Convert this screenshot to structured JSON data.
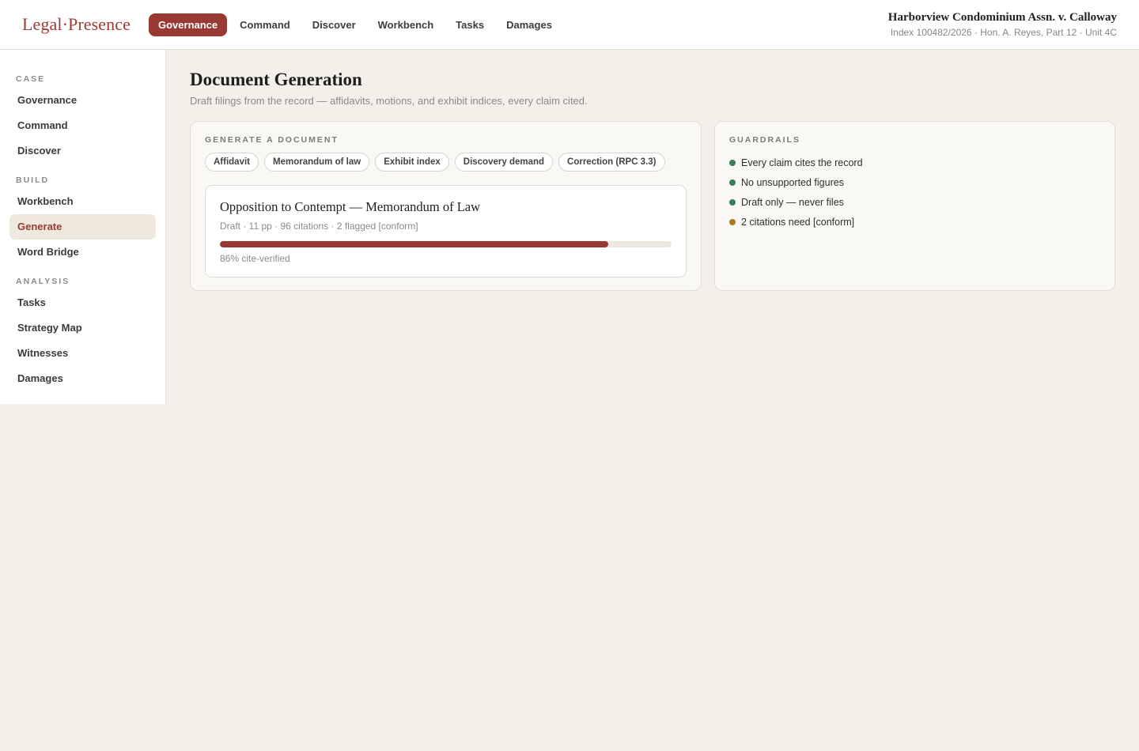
{
  "brand": {
    "logo": "Legal·Presence"
  },
  "topnav": {
    "items": [
      {
        "label": "Governance",
        "active": true
      },
      {
        "label": "Command",
        "active": false
      },
      {
        "label": "Discover",
        "active": false
      },
      {
        "label": "Workbench",
        "active": false
      },
      {
        "label": "Tasks",
        "active": false
      },
      {
        "label": "Damages",
        "active": false
      }
    ]
  },
  "case": {
    "title": "Harborview Condominium Assn. v. Calloway",
    "subtitle": "Index 100482/2026 · Hon. A. Reyes, Part 12 · Unit 4C"
  },
  "sidebar": {
    "sections": [
      {
        "label": "CASE",
        "items": [
          "Governance",
          "Command",
          "Discover"
        ]
      },
      {
        "label": "BUILD",
        "items": [
          "Workbench",
          "Generate",
          "Word Bridge"
        ]
      },
      {
        "label": "ANALYSIS",
        "items": [
          "Tasks",
          "Strategy Map",
          "Witnesses",
          "Damages"
        ]
      }
    ],
    "active_item": "Generate"
  },
  "page": {
    "title": "Document Generation",
    "subtitle": "Draft filings from the record — affidavits, motions, and exhibit indices, every claim cited."
  },
  "generate": {
    "label": "GENERATE A DOCUMENT",
    "doc_types": [
      "Affidavit",
      "Memorandum of law",
      "Exhibit index",
      "Discovery demand",
      "Correction (RPC 3.3)"
    ],
    "document": {
      "title": "Opposition to Contempt — Memorandum of Law",
      "meta": "Draft · 11 pp · 96 citations · 2 flagged [conform]",
      "progress_percent": 86,
      "progress_label": "86% cite-verified"
    }
  },
  "guardrails": {
    "label": "GUARDRAILS",
    "rules": [
      {
        "text": "Every claim cites the record",
        "status": "ok"
      },
      {
        "text": "No unsupported figures",
        "status": "ok"
      },
      {
        "text": "Draft only — never files",
        "status": "ok"
      },
      {
        "text": "2 citations need [conform]",
        "status": "warn"
      }
    ]
  },
  "colors": {
    "accent": "#983a33",
    "ok": "#3a7d57",
    "warn": "#a67c1c",
    "active_bg": "#efe8dd"
  }
}
